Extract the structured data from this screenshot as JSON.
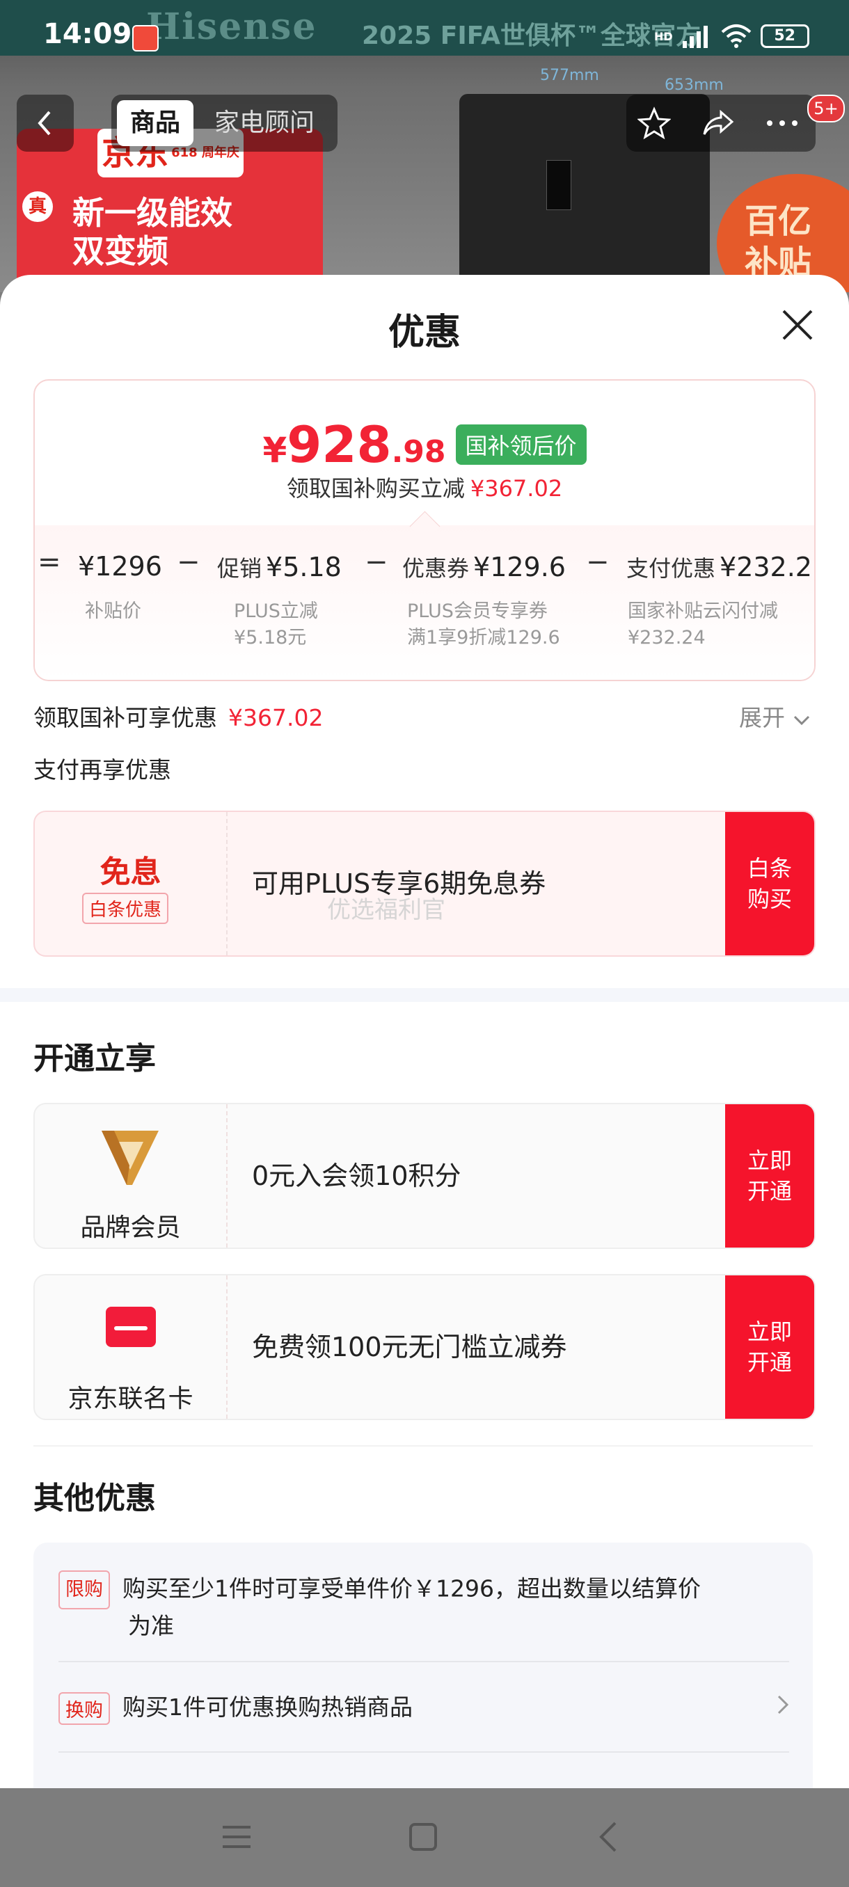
{
  "status_bar": {
    "time": "14:09",
    "battery": "52",
    "network": "HD",
    "icons": [
      "app-notification-icon",
      "signal-icon",
      "wifi-icon",
      "battery-icon"
    ]
  },
  "background": {
    "brand": "Hisense",
    "campaign": "2025 FIFA世俱杯™全球官方",
    "jd_anniv": "京东",
    "jd_anniv_sub": "618 周年庆",
    "badge_true": "真",
    "promo_line1": "新一级能效",
    "promo_line2": "双变频",
    "dim_width": "577mm",
    "dim_depth": "653mm",
    "subsidy_line1": "百亿",
    "subsidy_line2": "补贴"
  },
  "nav": {
    "tab_active": "商品",
    "tab_other": "家电顾问",
    "badge": "5+"
  },
  "sheet": {
    "title": "优惠",
    "price": {
      "yen": "¥",
      "int": "928",
      "dec": ".98",
      "tag": "国补领后价",
      "sub_label": "领取国补购买立减",
      "sub_amount": "¥367.02"
    },
    "breakdown": [
      {
        "op": "=",
        "label": "",
        "value": "¥1296",
        "desc1": "补贴价",
        "desc2": ""
      },
      {
        "op": "−",
        "label": "促销",
        "value": "¥5.18",
        "desc1": "PLUS立减",
        "desc2": "¥5.18元"
      },
      {
        "op": "−",
        "label": "优惠券",
        "value": "¥129.6",
        "desc1": "PLUS会员专享券",
        "desc2": "满1享9折减129.6"
      },
      {
        "op": "−",
        "label": "支付优惠",
        "value": "¥232.2",
        "desc1": "国家补贴云闪付减",
        "desc2": "¥232.24"
      }
    ],
    "claim_label": "领取国补可享优惠",
    "claim_amount": "¥367.02",
    "expand": "展开",
    "pay_more": "支付再享优惠",
    "coupon_interest": {
      "title": "免息",
      "tag": "白条优惠",
      "text": "可用PLUS专享6期免息券",
      "button_line1": "白条",
      "button_line2": "购买",
      "watermark": "优选福利官"
    },
    "open_section_title": "开通立享",
    "coupon_brand": {
      "label": "品牌会员",
      "text": "0元入会领10积分",
      "button_line1": "立即",
      "button_line2": "开通"
    },
    "coupon_card": {
      "label": "京东联名卡",
      "text": "免费领100元无门槛立减券",
      "button_line1": "立即",
      "button_line2": "开通"
    },
    "other_title": "其他优惠",
    "other": [
      {
        "tag": "限购",
        "line1": "购买至少1件时可享受单件价￥1296，超出数量以结算价",
        "line2": "为准"
      },
      {
        "tag": "换购",
        "line1": "购买1件可优惠换购热销商品",
        "line2": ""
      }
    ]
  },
  "colors": {
    "accent_red": "#f22335",
    "button_red": "#f5142c",
    "tag_green": "#3bae5c"
  }
}
